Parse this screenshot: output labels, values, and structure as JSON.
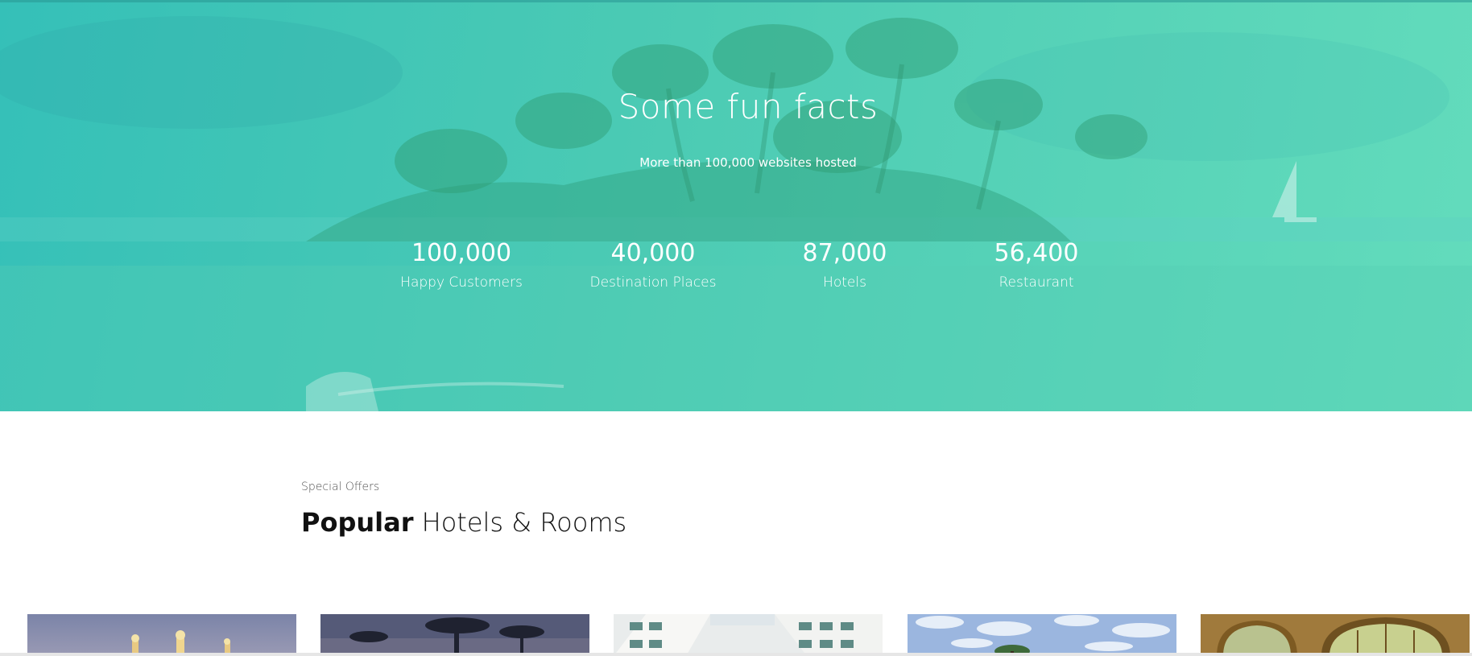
{
  "hero": {
    "title": "Some fun facts",
    "subtitle": "More than 100,000 websites hosted",
    "overlay_color_start": "#35c0b8",
    "overlay_color_end": "#63dcbc",
    "facts": [
      {
        "value": "100,000",
        "label": "Happy Customers"
      },
      {
        "value": "40,000",
        "label": "Destination Places"
      },
      {
        "value": "87,000",
        "label": "Hotels"
      },
      {
        "value": "56,400",
        "label": "Restaurant"
      }
    ]
  },
  "offers": {
    "kicker": "Special Offers",
    "heading_bold": "Popular",
    "heading_rest": " Hotels & Rooms",
    "cards": [
      {
        "image": "palace-at-dusk-photo"
      },
      {
        "image": "palm-trees-dusk-photo"
      },
      {
        "image": "white-hotel-building-photo"
      },
      {
        "image": "cloudy-sky-palm-photo"
      },
      {
        "image": "ornate-room-interior-photo"
      }
    ]
  }
}
